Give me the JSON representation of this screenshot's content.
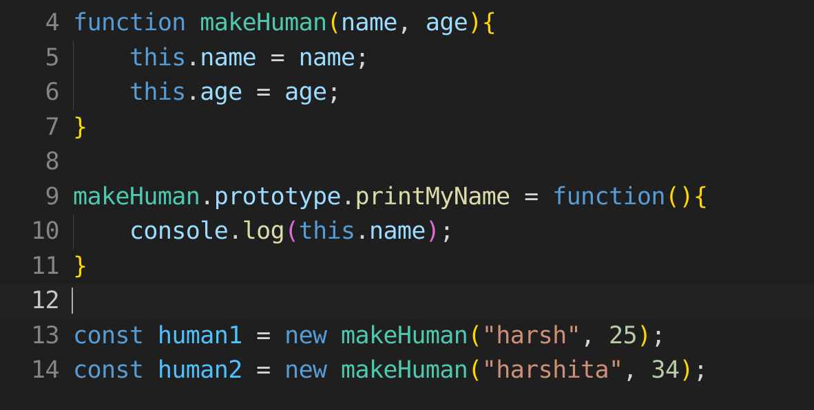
{
  "editor": {
    "lines": [
      {
        "number": "4",
        "tokens": [
          {
            "text": "function",
            "type": "kw"
          },
          {
            "text": " ",
            "type": "punc"
          },
          {
            "text": "makeHuman",
            "type": "fn"
          },
          {
            "text": "(",
            "type": "b1"
          },
          {
            "text": "name",
            "type": "var"
          },
          {
            "text": ", ",
            "type": "punc"
          },
          {
            "text": "age",
            "type": "var"
          },
          {
            "text": ")",
            "type": "b1"
          },
          {
            "text": "{",
            "type": "b1"
          }
        ]
      },
      {
        "number": "5",
        "guide": true,
        "tokens": [
          {
            "text": "    ",
            "type": "punc"
          },
          {
            "text": "this",
            "type": "kw"
          },
          {
            "text": ".",
            "type": "punc"
          },
          {
            "text": "name",
            "type": "prop"
          },
          {
            "text": " = ",
            "type": "punc"
          },
          {
            "text": "name",
            "type": "var"
          },
          {
            "text": ";",
            "type": "punc"
          }
        ]
      },
      {
        "number": "6",
        "guide": true,
        "tokens": [
          {
            "text": "    ",
            "type": "punc"
          },
          {
            "text": "this",
            "type": "kw"
          },
          {
            "text": ".",
            "type": "punc"
          },
          {
            "text": "age",
            "type": "prop"
          },
          {
            "text": " = ",
            "type": "punc"
          },
          {
            "text": "age",
            "type": "var"
          },
          {
            "text": ";",
            "type": "punc"
          }
        ]
      },
      {
        "number": "7",
        "tokens": [
          {
            "text": "}",
            "type": "b1"
          }
        ]
      },
      {
        "number": "8",
        "tokens": []
      },
      {
        "number": "9",
        "tokens": [
          {
            "text": "makeHuman",
            "type": "fn"
          },
          {
            "text": ".",
            "type": "punc"
          },
          {
            "text": "prototype",
            "type": "prop"
          },
          {
            "text": ".",
            "type": "punc"
          },
          {
            "text": "printMyName",
            "type": "fncall"
          },
          {
            "text": " = ",
            "type": "punc"
          },
          {
            "text": "function",
            "type": "kw"
          },
          {
            "text": "(",
            "type": "b1"
          },
          {
            "text": ")",
            "type": "b1"
          },
          {
            "text": "{",
            "type": "b1"
          }
        ]
      },
      {
        "number": "10",
        "guide": true,
        "tokens": [
          {
            "text": "    ",
            "type": "punc"
          },
          {
            "text": "console",
            "type": "var"
          },
          {
            "text": ".",
            "type": "punc"
          },
          {
            "text": "log",
            "type": "fncall"
          },
          {
            "text": "(",
            "type": "b2"
          },
          {
            "text": "this",
            "type": "kw"
          },
          {
            "text": ".",
            "type": "punc"
          },
          {
            "text": "name",
            "type": "prop"
          },
          {
            "text": ")",
            "type": "b2"
          },
          {
            "text": ";",
            "type": "punc"
          }
        ]
      },
      {
        "number": "11",
        "tokens": [
          {
            "text": "}",
            "type": "b1"
          }
        ]
      },
      {
        "number": "12",
        "current": true,
        "tokens": []
      },
      {
        "number": "13",
        "tokens": [
          {
            "text": "const",
            "type": "kw"
          },
          {
            "text": " ",
            "type": "punc"
          },
          {
            "text": "human1",
            "type": "const"
          },
          {
            "text": " = ",
            "type": "punc"
          },
          {
            "text": "new",
            "type": "kw"
          },
          {
            "text": " ",
            "type": "punc"
          },
          {
            "text": "makeHuman",
            "type": "fn"
          },
          {
            "text": "(",
            "type": "b1"
          },
          {
            "text": "\"harsh\"",
            "type": "str"
          },
          {
            "text": ", ",
            "type": "punc"
          },
          {
            "text": "25",
            "type": "num"
          },
          {
            "text": ")",
            "type": "b1"
          },
          {
            "text": ";",
            "type": "punc"
          }
        ]
      },
      {
        "number": "14",
        "tokens": [
          {
            "text": "const",
            "type": "kw"
          },
          {
            "text": " ",
            "type": "punc"
          },
          {
            "text": "human2",
            "type": "const"
          },
          {
            "text": " = ",
            "type": "punc"
          },
          {
            "text": "new",
            "type": "kw"
          },
          {
            "text": " ",
            "type": "punc"
          },
          {
            "text": "makeHuman",
            "type": "fn"
          },
          {
            "text": "(",
            "type": "b1"
          },
          {
            "text": "\"harshita\"",
            "type": "str"
          },
          {
            "text": ", ",
            "type": "punc"
          },
          {
            "text": "34",
            "type": "num"
          },
          {
            "text": ")",
            "type": "b1"
          },
          {
            "text": ";",
            "type": "punc"
          }
        ]
      }
    ]
  }
}
